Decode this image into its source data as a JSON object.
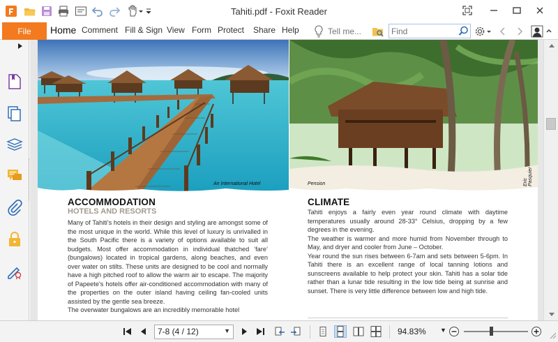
{
  "app": {
    "title": "Tahiti.pdf - Foxit Reader"
  },
  "ribbon": {
    "file_tab": "File",
    "tabs": [
      "Home",
      "Comment",
      "Fill & Sign",
      "View",
      "Form",
      "Protect",
      "Share",
      "Help"
    ],
    "active_tab": "Home",
    "tell_me": "Tell me...",
    "search_placeholder": "Find"
  },
  "sidebar": {
    "items": [
      "bookmark-icon",
      "pages-icon",
      "layers-icon",
      "comments-icon",
      "attachments-icon",
      "security-icon",
      "signature-icon"
    ]
  },
  "document": {
    "left_photo_caption": "An International Hotel",
    "right_photo_caption": "Pension",
    "photo_credit": "Eric Pasquier",
    "accommodation": {
      "title": "ACCOMMODATION",
      "subtitle": "HOTELS AND RESORTS",
      "body": "Many of Tahiti's hotels in their design and styling are amongst some of the most unique in the world. While this level of luxury is unrivalled in the South Pacific there is a variety of options available to suit all budgets. Most offer accommodation in individual thatched ‘fare’ (bungalows) located in tropical gardens, along beaches, and even over water on stilts. These units are designed to be cool and  normally have a high pitched roof to allow the warm air to escape. The majority of Papeete's hotels offer air-conditioned accommodation with many of the properties on the outer island having ceiling fan-cooled units assisted by the gentle sea breeze.",
      "body_cut": "The overwater bungalows are an incredibly memorable hotel"
    },
    "climate": {
      "title": "CLIMATE",
      "paragraphs": [
        "Tahiti enjoys a fairly even year round climate with daytime temperatures usually around 28-33° Celsius, dropping by a few degrees in the evening.",
        "The weather is warmer and more humid from November through to May, and dryer and cooler from June – October.",
        "Year round the sun rises between 6-7am and sets between 5-6pm. In Tahiti there is an excellent range of local tanning lotions and sunscreens available to help protect your skin. Tahiti has a solar tide rather than a lunar tide resulting in the low tide being at sunrise and sunset. There is very little difference between low and high tide."
      ]
    }
  },
  "statusbar": {
    "page_label": "7-8 (4 / 12)",
    "zoom_label": "94.83%",
    "zoom_level_fraction": 0.43
  },
  "colors": {
    "accent": "#f37a1f",
    "subtitle": "#a39a8f"
  }
}
